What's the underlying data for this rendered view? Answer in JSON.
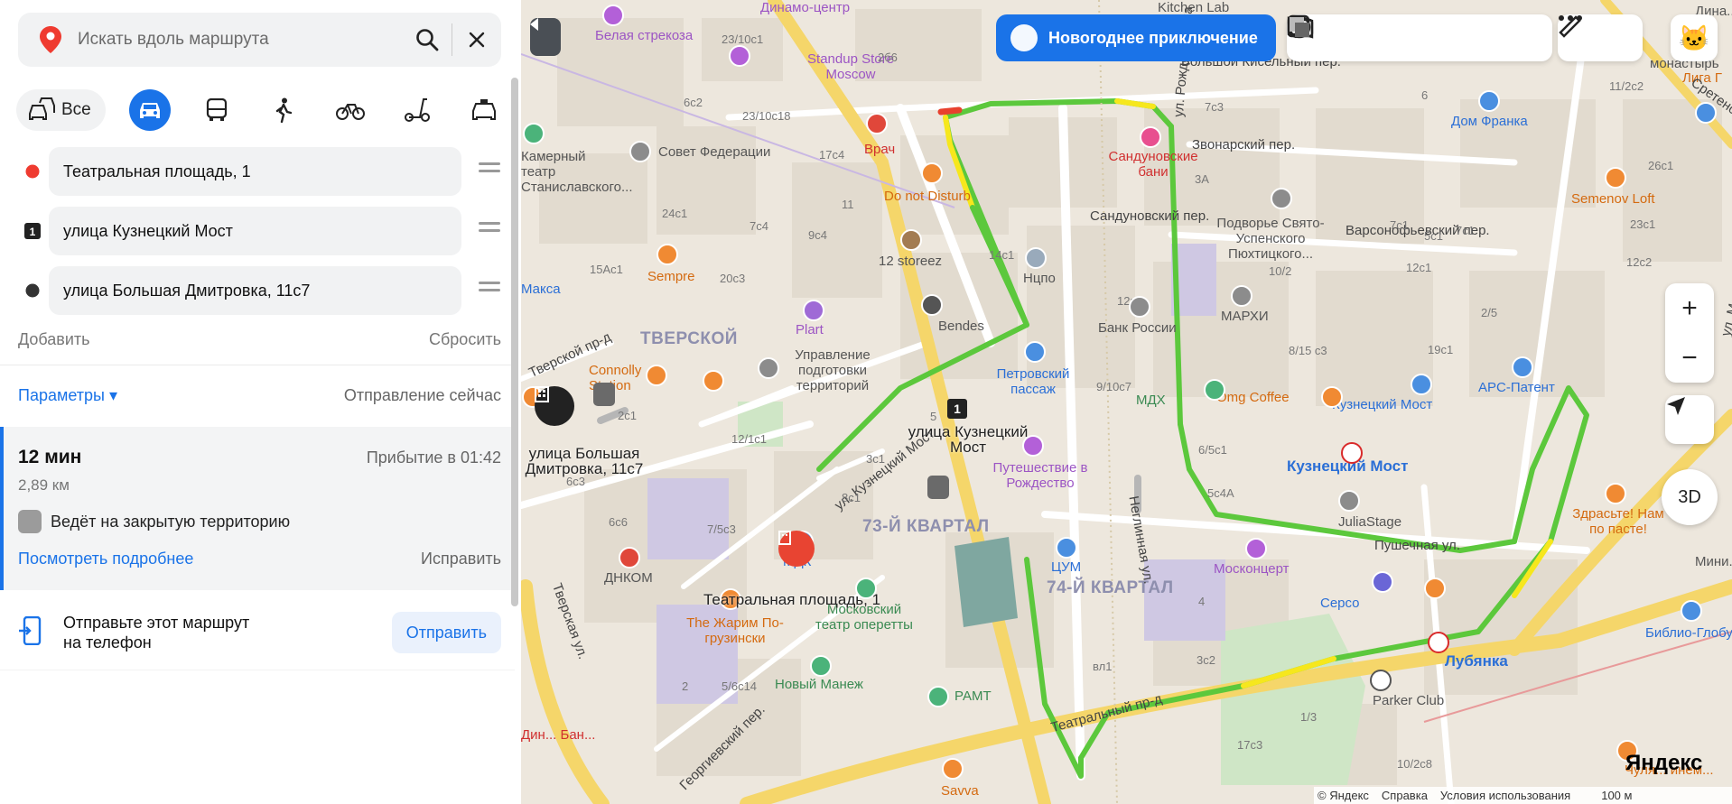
{
  "search": {
    "placeholder": "Искать вдоль маршрута"
  },
  "modes": {
    "all_label": "Все"
  },
  "waypoints": [
    {
      "marker": "",
      "label": "Театральная площадь, 1"
    },
    {
      "marker": "1",
      "label": "улица Кузнецкий Мост"
    },
    {
      "marker": "",
      "label": "улица Большая Дмитровка, 11с7"
    }
  ],
  "actions": {
    "add": "Добавить",
    "reset": "Сбросить"
  },
  "params": {
    "label": "Параметры ▾",
    "departure": "Отправление сейчас"
  },
  "route": {
    "duration": "12 мин",
    "distance": "2,89 км",
    "arrival": "Прибытие в 01:42",
    "warning": "Ведёт на закрытую территорию",
    "details_link": "Посмотреть подробнее",
    "fix": "Исправить"
  },
  "send": {
    "text_line1": "Отправьте этот маршрут",
    "text_line2": "на телефон",
    "button": "Отправить"
  },
  "promo": {
    "label": "Новогоднее приключение"
  },
  "map_controls": {
    "zoom_in": "+",
    "zoom_out": "−",
    "three_d": "3D"
  },
  "branding": {
    "logo": "Яндекс"
  },
  "footer": {
    "copyright": "© Яндекс",
    "help": "Справка",
    "terms": "Условия использования",
    "scale": "100 м"
  },
  "colors": {
    "accent": "#1a73e8",
    "route_green": "#5cc83c",
    "route_yellow": "#f6e71d",
    "route_red": "#e8412e",
    "metro": "#d92b2b"
  },
  "map_labels": {
    "poi_1": "Белая стрекоза",
    "poi_2": "Standup Store Moscow",
    "poi_3": "Врач",
    "poi_4": "Do not Disturb",
    "poi_5": "Совет Федерации",
    "poi_6": "12 storeez",
    "poi_7": "Bendes",
    "poi_8": "Sempre",
    "poi_9": "Plart",
    "poi_10": "Управление подготовки территорий",
    "poi_11": "Connolly Station",
    "poi_12": "Нцпо",
    "poi_13": "Банк России",
    "poi_14": "Петровский пассаж",
    "poi_15": "МАРХИ",
    "poi_16": "МДХ",
    "poi_17": "Omg Coffee",
    "poi_18": "Сандуновские бани",
    "poi_19": "Подворье Свято-Успенского Пюхтицкого...",
    "poi_20": "Дом Франка",
    "poi_21": "Semenov Loft",
    "poi_22": "Кузнецкий Мост",
    "poi_23": "Кузнецкий Мост",
    "poi_24": "APC-Патент",
    "poi_25": "JuliaStage",
    "poi_26": "Путешествие в Рождество",
    "poi_27": "ЦУМ",
    "poi_28": "Москонцерт",
    "poi_29": "Серсо",
    "poi_30": "МДК",
    "poi_31": "ДНКОМ",
    "poi_32": "Московский театр оперетты",
    "poi_33": "The Жарим По-грузински",
    "poi_34": "Новый Манеж",
    "poi_35": "РАМТ",
    "poi_36": "Лубянка",
    "poi_37": "Parker Club",
    "poi_38": "Библио-Глобус",
    "poi_39": "Здрасьте! Нам по пасте!",
    "poi_40": "Лига Г",
    "poi_41": "Savva",
    "poi_42": "Чуля... инем...",
    "poi_43": "Макса",
    "poi_44": "Дин... Бан...",
    "poi_45": "Мини...",
    "poi_46": "Дина..."
  },
  "map_pins": {
    "dest_label": "улица Большая Дмитровка, 11с7",
    "waypoint_label": "улица Кузнецкий Мост",
    "start_label": "Театральная площадь, 1"
  },
  "districts": {
    "d1": "ТВЕРСКОЙ",
    "d2": "73-Й КВАРТАЛ",
    "d3": "74-Й КВАРТАЛ"
  },
  "streets": {
    "s1": "Большой Кисельный пер.",
    "s2": "Звонарский пер.",
    "s3": "Сандуновский пер.",
    "s4": "Варсонофьевский пер.",
    "s5": "Пушечная ул.",
    "s6": "Неглинная ул.",
    "s7": "ул. Кузнецкий Мост",
    "s8": "Тверская ул.",
    "s9": "Театральный пр-д",
    "s10": "Тверской пр-д",
    "s11": "Георгиевский пер.",
    "s12": "ул. Рождественка",
    "s13": "ул. Малая Лубянка",
    "s14": "Сретенский",
    "s15": "Динамо-центр",
    "s16": "Kitchen Lab",
    "s17": "монастырь"
  },
  "theatre": {
    "t1": "Камерный театр",
    "t2": "Станиславского..."
  },
  "houses": [
    "23/10с1",
    "2б6",
    "6с2",
    "23/10с18",
    "17с4",
    "11",
    "24с1",
    "7с4",
    "9с4",
    "20с3",
    "15Ас1",
    "14с1",
    "2с1",
    "12/1с1",
    "3с1",
    "6с3",
    "8с1",
    "7/5с3",
    "6с6",
    "5",
    "2",
    "5/6с14",
    "3с2",
    "1/3",
    "вл1",
    "10/2с8",
    "17с3",
    "3А",
    "7с3",
    "6",
    "12кс",
    "5с1",
    "7с1",
    "10/2",
    "8/15 с3",
    "9/10с7",
    "6/5с1",
    "5с4А",
    "19с1",
    "4",
    "12с1",
    "2/5",
    "11/2с2",
    "7с1",
    "26с1",
    "23с1",
    "12с2"
  ]
}
